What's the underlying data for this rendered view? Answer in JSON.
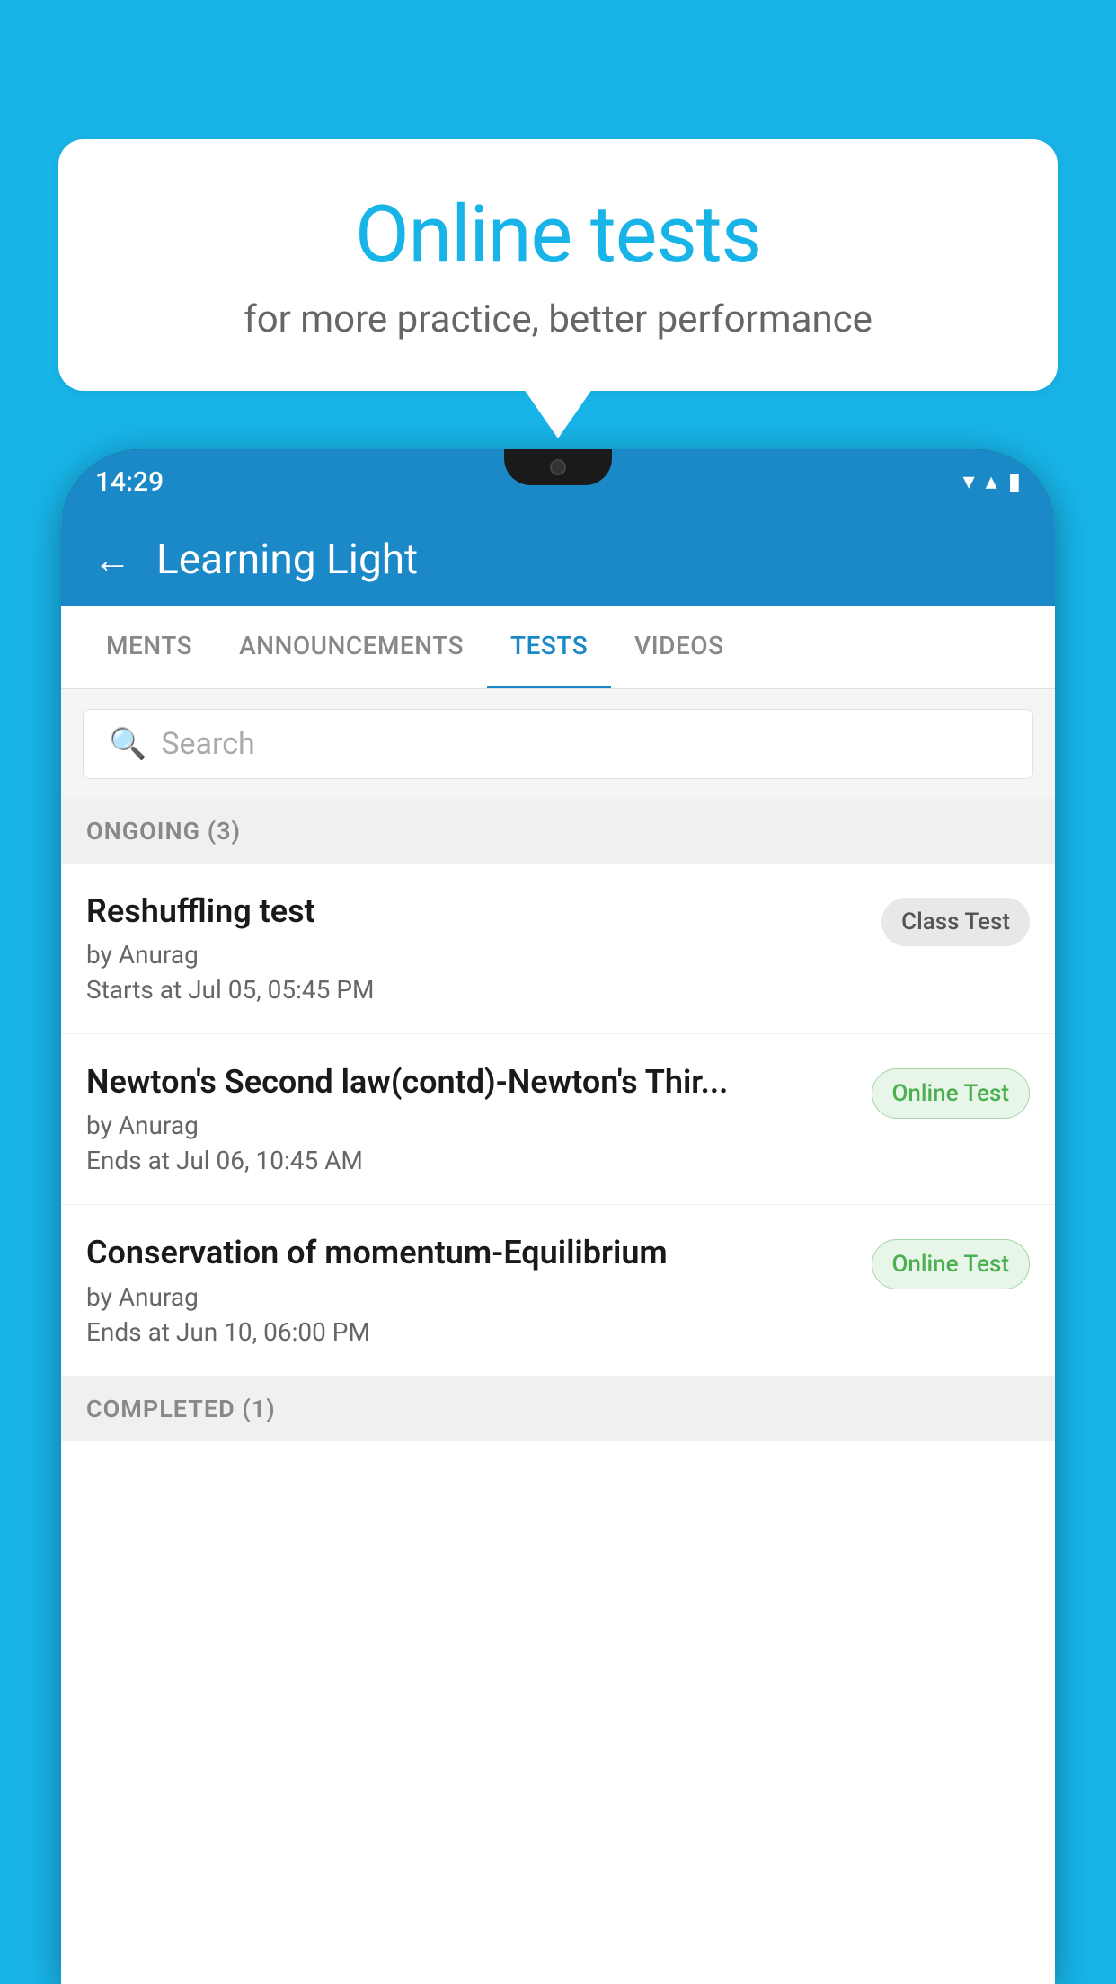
{
  "background_color": "#18B4E8",
  "bubble": {
    "title": "Online tests",
    "subtitle": "for more practice, better performance"
  },
  "phone": {
    "status_bar": {
      "time": "14:29",
      "wifi": "▼",
      "signal": "▲",
      "battery": "▌"
    },
    "app_header": {
      "title": "Learning Light",
      "back_label": "←"
    },
    "tabs": [
      {
        "label": "MENTS",
        "active": false
      },
      {
        "label": "ANNOUNCEMENTS",
        "active": false
      },
      {
        "label": "TESTS",
        "active": true
      },
      {
        "label": "VIDEOS",
        "active": false
      }
    ],
    "search": {
      "placeholder": "Search"
    },
    "ongoing_section": {
      "label": "ONGOING (3)"
    },
    "tests": [
      {
        "name": "Reshuffling test",
        "by": "by Anurag",
        "time": "Starts at  Jul 05, 05:45 PM",
        "badge": "Class Test",
        "badge_type": "class"
      },
      {
        "name": "Newton's Second law(contd)-Newton's Thir...",
        "by": "by Anurag",
        "time": "Ends at  Jul 06, 10:45 AM",
        "badge": "Online Test",
        "badge_type": "online"
      },
      {
        "name": "Conservation of momentum-Equilibrium",
        "by": "by Anurag",
        "time": "Ends at  Jun 10, 06:00 PM",
        "badge": "Online Test",
        "badge_type": "online"
      }
    ],
    "completed_section": {
      "label": "COMPLETED (1)"
    }
  }
}
